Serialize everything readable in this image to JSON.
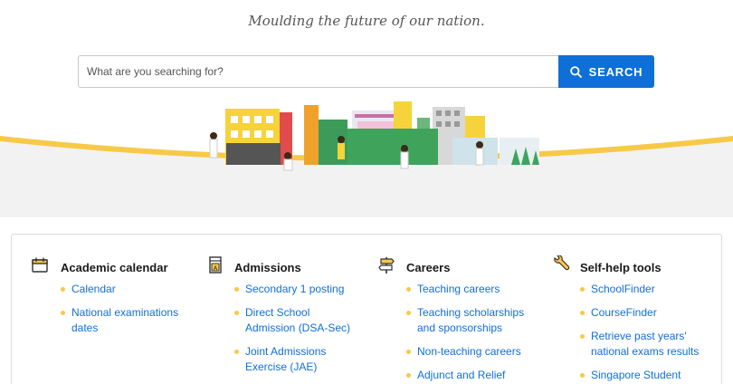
{
  "tagline": "Moulding the future of our nation.",
  "search": {
    "placeholder": "What are you searching for?",
    "button_label": "SEARCH"
  },
  "categories": [
    {
      "title": "Academic calendar",
      "icon": "calendar-icon",
      "links": [
        "Calendar",
        "National examinations dates"
      ]
    },
    {
      "title": "Admissions",
      "icon": "admissions-icon",
      "links": [
        "Secondary 1 posting",
        "Direct School Admission (DSA-Sec)",
        "Joint Admissions Exercise (JAE)"
      ]
    },
    {
      "title": "Careers",
      "icon": "signpost-icon",
      "links": [
        "Teaching careers",
        "Teaching scholarships and sponsorships",
        "Non-teaching careers",
        "Adjunct and Relief"
      ]
    },
    {
      "title": "Self-help tools",
      "icon": "wrench-icon",
      "links": [
        "SchoolFinder",
        "CourseFinder",
        "Retrieve past years' national exams results",
        "Singapore Student"
      ]
    }
  ],
  "colors": {
    "brand_blue": "#0f6fd8",
    "accent_yellow": "#f7c948"
  }
}
